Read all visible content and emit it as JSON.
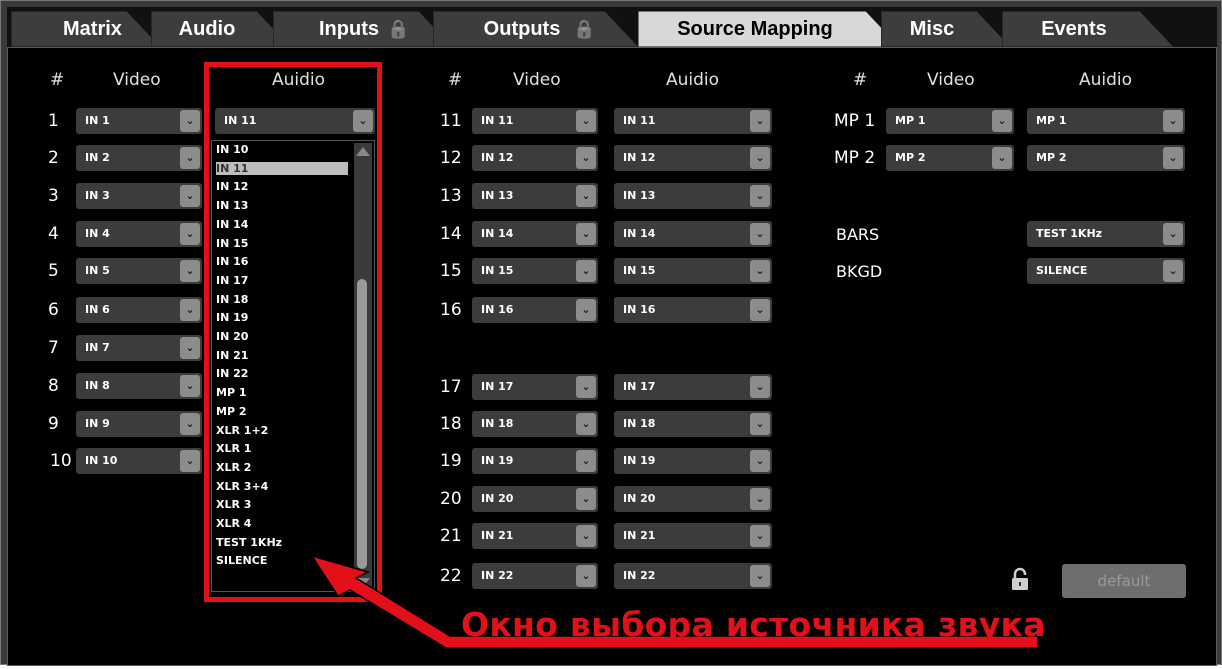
{
  "tabs": [
    {
      "label": "Matrix",
      "locked": false,
      "active": false
    },
    {
      "label": "Audio",
      "locked": false,
      "active": false
    },
    {
      "label": "Inputs",
      "locked": true,
      "active": false
    },
    {
      "label": "Outputs",
      "locked": true,
      "active": false
    },
    {
      "label": "Source Mapping",
      "locked": false,
      "active": true
    },
    {
      "label": "Misc",
      "locked": false,
      "active": false
    },
    {
      "label": "Events",
      "locked": false,
      "active": false
    }
  ],
  "columns": {
    "c1": {
      "num": "#",
      "video": "Video",
      "audio": "Auidio"
    },
    "c2": {
      "num": "#",
      "video": "Video",
      "audio": "Auidio"
    },
    "c3": {
      "num": "#",
      "video": "Video",
      "audio": "Auidio"
    }
  },
  "group1": [
    {
      "n": "1",
      "video": "IN 1",
      "audio": "IN 11"
    },
    {
      "n": "2",
      "video": "IN 2"
    },
    {
      "n": "3",
      "video": "IN 3"
    },
    {
      "n": "4",
      "video": "IN 4"
    },
    {
      "n": "5",
      "video": "IN 5"
    },
    {
      "n": "6",
      "video": "IN 6"
    },
    {
      "n": "7",
      "video": "IN 7"
    },
    {
      "n": "8",
      "video": "IN 8"
    },
    {
      "n": "9",
      "video": "IN 9"
    },
    {
      "n": "10",
      "video": "IN 10"
    }
  ],
  "group2": [
    {
      "n": "11",
      "video": "IN 11",
      "audio": "IN 11"
    },
    {
      "n": "12",
      "video": "IN 12",
      "audio": "IN 12"
    },
    {
      "n": "13",
      "video": "IN 13",
      "audio": "IN 13"
    },
    {
      "n": "14",
      "video": "IN 14",
      "audio": "IN 14"
    },
    {
      "n": "15",
      "video": "IN 15",
      "audio": "IN 15"
    },
    {
      "n": "16",
      "video": "IN 16",
      "audio": "IN 16"
    },
    {
      "n": "17",
      "video": "IN 17",
      "audio": "IN 17"
    },
    {
      "n": "18",
      "video": "IN 18",
      "audio": "IN 18"
    },
    {
      "n": "19",
      "video": "IN 19",
      "audio": "IN 19"
    },
    {
      "n": "20",
      "video": "IN 20",
      "audio": "IN 20"
    },
    {
      "n": "21",
      "video": "IN 21",
      "audio": "IN 21"
    },
    {
      "n": "22",
      "video": "IN 22",
      "audio": "IN 22"
    }
  ],
  "group3": [
    {
      "n": "MP 1",
      "video": "MP 1",
      "audio": "MP 1"
    },
    {
      "n": "MP 2",
      "video": "MP 2",
      "audio": "MP 2"
    }
  ],
  "special": [
    {
      "label": "BARS",
      "audio": "TEST 1KHz"
    },
    {
      "label": "BKGD",
      "audio": "SILENCE"
    }
  ],
  "audio_list": {
    "options": [
      "IN 10",
      "IN 11",
      "IN 12",
      "IN 13",
      "IN 14",
      "IN 15",
      "IN 16",
      "IN 17",
      "IN 18",
      "IN 19",
      "IN 20",
      "IN 21",
      "IN 22",
      "MP 1",
      "MP 2",
      "XLR 1+2",
      "XLR 1",
      "XLR 2",
      "XLR 3+4",
      "XLR 3",
      "XLR 4",
      "TEST 1KHz",
      "SILENCE"
    ],
    "selected": "IN 11"
  },
  "default_button": "default",
  "annotation": "Окно выбора источника звука",
  "colors": {
    "accent": "#e3101a",
    "tab_active": "#d8d8d8",
    "tab_inactive": "#3d3d3d"
  }
}
